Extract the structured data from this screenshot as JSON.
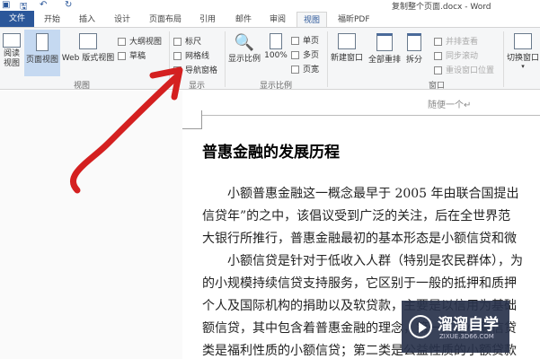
{
  "window": {
    "title": "复制整个页面.docx - Word"
  },
  "tabs": [
    "文件",
    "开始",
    "插入",
    "设计",
    "页面布局",
    "引用",
    "邮件",
    "审阅",
    "视图",
    "福昕PDF"
  ],
  "ribbon": {
    "views": {
      "read": "阅读\n视图",
      "print": "页面视图",
      "web": "Web 版式视图",
      "outline": "大纲视图",
      "draft": "草稿",
      "group": "视图"
    },
    "show": {
      "ruler": "标尺",
      "grid": "网格线",
      "nav": "导航窗格",
      "group": "显示"
    },
    "zoom": {
      "zoom": "显示比例",
      "pct": "100%",
      "one": "单页",
      "multi": "多页",
      "width": "页宽",
      "group": "显示比例"
    },
    "window": {
      "new": "新建窗口",
      "arrange": "全部重排",
      "split": "拆分",
      "side": "并排查看",
      "sync": "同步滚动",
      "reset": "重设窗口位置",
      "switch": "切换窗口",
      "group": "窗口"
    }
  },
  "document": {
    "header": "随便一个↵",
    "heading": "普惠金融的发展历程",
    "lines": [
      "　　小额普惠金融这一概念最早于 2005 年由联合国提出",
      "信贷年”的之中，该倡议受到广泛的关注，后在全世界范",
      "大银行所推行，普惠金融最初的基本形态是小额信贷和微",
      "　　小额信贷是针对于低收入人群（特别是农民群体），为",
      "的小规模持续信贷支持服务，它区别于一般的抵押和质押",
      "个人及国际机构的捐助以及软贷款，主要是以信用为基础",
      "额信贷，其中包含着普惠金融的理念，第一类是小额信贷",
      "类是福利性质的小额信贷；第二类是公益性质的小额贷款"
    ]
  },
  "watermark": {
    "name": "溜溜自学",
    "url": "ZIXUE.3D66.COM"
  },
  "annotation_color": "#d42020"
}
